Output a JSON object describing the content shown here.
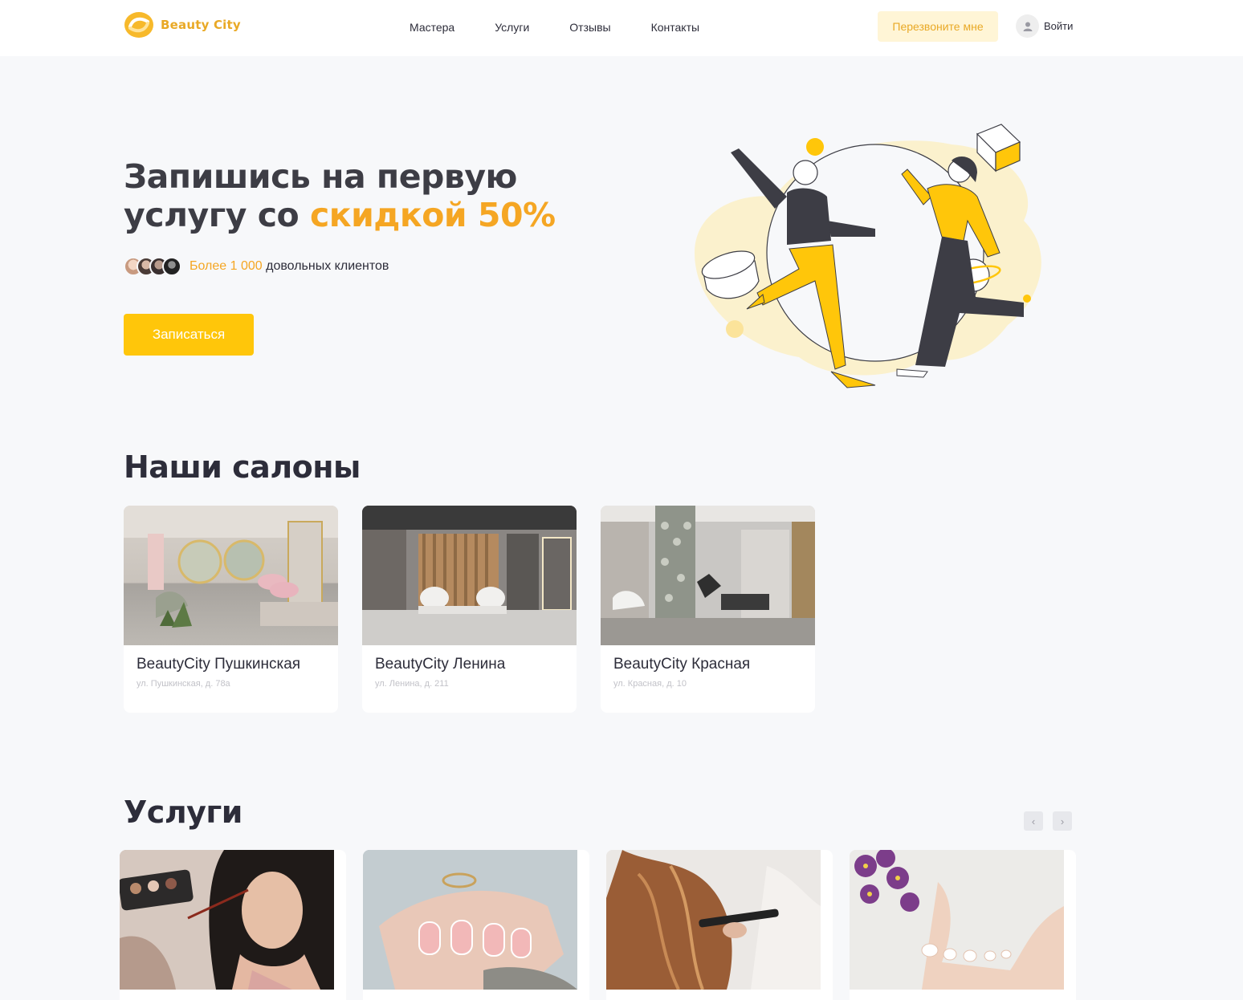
{
  "brand": {
    "name": "Beauty City",
    "accent": "#f5a623",
    "button": "#ffc60a"
  },
  "nav": {
    "items": [
      {
        "label": "Мастера"
      },
      {
        "label": "Услуги"
      },
      {
        "label": "Отзывы"
      },
      {
        "label": "Контакты"
      }
    ],
    "callback_label": "Перезвоните мне",
    "login_label": "Войти"
  },
  "hero": {
    "title_part1": "Запишись на первую услугу со ",
    "title_accent": "скидкой 50%",
    "clients_highlight": "Более 1 000",
    "clients_rest": " довольных клиентов",
    "cta_label": "Записаться"
  },
  "salons": {
    "title": "Наши салоны",
    "items": [
      {
        "name": "BeautyCity Пушкинская",
        "address": "ул. Пушкинская, д. 78а"
      },
      {
        "name": "BeautyCity Ленина",
        "address": "ул. Ленина, д. 211"
      },
      {
        "name": "BeautyCity Красная",
        "address": "ул. Красная, д. 10"
      }
    ]
  },
  "services": {
    "title": "Услуги",
    "prev_icon": "‹",
    "next_icon": "›"
  }
}
